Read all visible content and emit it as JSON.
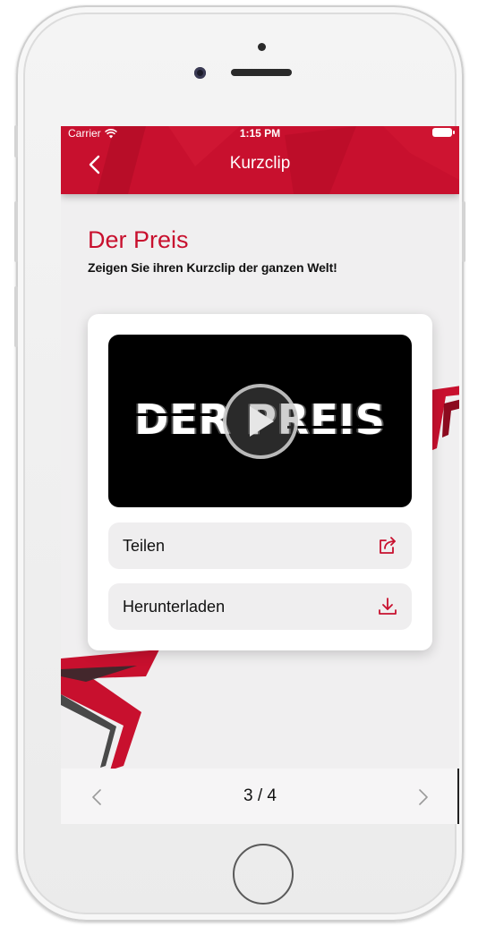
{
  "status_bar": {
    "carrier": "Carrier",
    "time": "1:15 PM"
  },
  "nav": {
    "title": "Kurzclip",
    "back_icon": "chevron-left-icon"
  },
  "page": {
    "title": "Der Preis",
    "subtitle": "Zeigen Sie ihren Kurzclip der ganzen Welt!"
  },
  "video": {
    "title": "DER PREIS",
    "play_icon": "play-icon"
  },
  "actions": [
    {
      "label": "Teilen",
      "icon": "share-icon"
    },
    {
      "label": "Herunterladen",
      "icon": "download-icon"
    }
  ],
  "pager": {
    "current": "3 / 4",
    "prev_icon": "chevron-left-icon",
    "next_icon": "chevron-right-icon"
  },
  "colors": {
    "accent": "#c8102e",
    "background": "#f0eff0",
    "card": "#ffffff",
    "row": "#efeeef"
  }
}
